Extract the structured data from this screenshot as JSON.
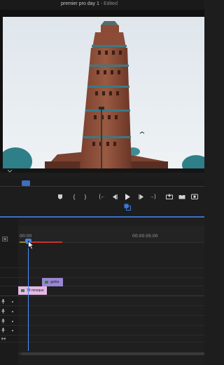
{
  "window": {
    "project_name": "premier pro day 1",
    "separator": "-",
    "status": "Edited"
  },
  "program_monitor": {
    "video_subject": "minaret-tower-photo"
  },
  "transport_controls": {
    "buttons": [
      {
        "name": "add-marker-icon"
      },
      {
        "name": "mark-in-icon",
        "glyph": "{"
      },
      {
        "name": "mark-out-icon",
        "glyph": "}"
      },
      {
        "name": "go-to-in-icon",
        "glyph": "{←"
      },
      {
        "name": "step-back-icon"
      },
      {
        "name": "play-icon"
      },
      {
        "name": "step-forward-icon"
      },
      {
        "name": "go-to-out-icon",
        "glyph": "→}"
      },
      {
        "name": "insert-icon"
      },
      {
        "name": "overwrite-icon"
      },
      {
        "name": "export-frame-icon"
      }
    ]
  },
  "timeline": {
    "ruler": {
      "start_label": "00:00",
      "mark_label": "00:00:05:00"
    },
    "clips": [
      {
        "label": "gulira",
        "color": "#9b86d6",
        "track": "V2"
      },
      {
        "label": "79 mosque",
        "color": "#e4b8e4",
        "track": "V1"
      }
    ],
    "accent_color": "#3a6fc4",
    "render_bar_color": "#c8312a"
  }
}
